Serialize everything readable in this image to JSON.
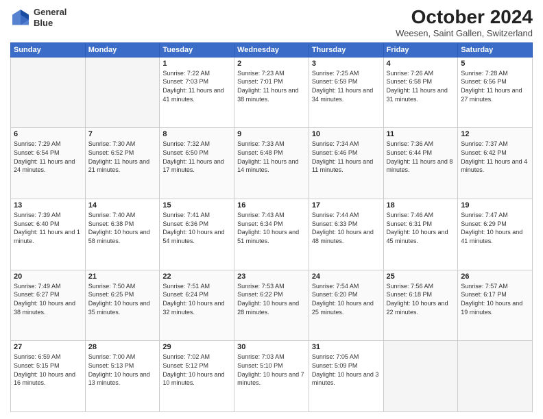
{
  "header": {
    "logo_line1": "General",
    "logo_line2": "Blue",
    "month": "October 2024",
    "location": "Weesen, Saint Gallen, Switzerland"
  },
  "weekdays": [
    "Sunday",
    "Monday",
    "Tuesday",
    "Wednesday",
    "Thursday",
    "Friday",
    "Saturday"
  ],
  "weeks": [
    [
      {
        "day": "",
        "empty": true
      },
      {
        "day": "",
        "empty": true
      },
      {
        "day": "1",
        "rise": "7:22 AM",
        "set": "7:03 PM",
        "daylight": "11 hours and 41 minutes."
      },
      {
        "day": "2",
        "rise": "7:23 AM",
        "set": "7:01 PM",
        "daylight": "11 hours and 38 minutes."
      },
      {
        "day": "3",
        "rise": "7:25 AM",
        "set": "6:59 PM",
        "daylight": "11 hours and 34 minutes."
      },
      {
        "day": "4",
        "rise": "7:26 AM",
        "set": "6:58 PM",
        "daylight": "11 hours and 31 minutes."
      },
      {
        "day": "5",
        "rise": "7:28 AM",
        "set": "6:56 PM",
        "daylight": "11 hours and 27 minutes."
      }
    ],
    [
      {
        "day": "6",
        "rise": "7:29 AM",
        "set": "6:54 PM",
        "daylight": "11 hours and 24 minutes."
      },
      {
        "day": "7",
        "rise": "7:30 AM",
        "set": "6:52 PM",
        "daylight": "11 hours and 21 minutes."
      },
      {
        "day": "8",
        "rise": "7:32 AM",
        "set": "6:50 PM",
        "daylight": "11 hours and 17 minutes."
      },
      {
        "day": "9",
        "rise": "7:33 AM",
        "set": "6:48 PM",
        "daylight": "11 hours and 14 minutes."
      },
      {
        "day": "10",
        "rise": "7:34 AM",
        "set": "6:46 PM",
        "daylight": "11 hours and 11 minutes."
      },
      {
        "day": "11",
        "rise": "7:36 AM",
        "set": "6:44 PM",
        "daylight": "11 hours and 8 minutes."
      },
      {
        "day": "12",
        "rise": "7:37 AM",
        "set": "6:42 PM",
        "daylight": "11 hours and 4 minutes."
      }
    ],
    [
      {
        "day": "13",
        "rise": "7:39 AM",
        "set": "6:40 PM",
        "daylight": "11 hours and 1 minute."
      },
      {
        "day": "14",
        "rise": "7:40 AM",
        "set": "6:38 PM",
        "daylight": "10 hours and 58 minutes."
      },
      {
        "day": "15",
        "rise": "7:41 AM",
        "set": "6:36 PM",
        "daylight": "10 hours and 54 minutes."
      },
      {
        "day": "16",
        "rise": "7:43 AM",
        "set": "6:34 PM",
        "daylight": "10 hours and 51 minutes."
      },
      {
        "day": "17",
        "rise": "7:44 AM",
        "set": "6:33 PM",
        "daylight": "10 hours and 48 minutes."
      },
      {
        "day": "18",
        "rise": "7:46 AM",
        "set": "6:31 PM",
        "daylight": "10 hours and 45 minutes."
      },
      {
        "day": "19",
        "rise": "7:47 AM",
        "set": "6:29 PM",
        "daylight": "10 hours and 41 minutes."
      }
    ],
    [
      {
        "day": "20",
        "rise": "7:49 AM",
        "set": "6:27 PM",
        "daylight": "10 hours and 38 minutes."
      },
      {
        "day": "21",
        "rise": "7:50 AM",
        "set": "6:25 PM",
        "daylight": "10 hours and 35 minutes."
      },
      {
        "day": "22",
        "rise": "7:51 AM",
        "set": "6:24 PM",
        "daylight": "10 hours and 32 minutes."
      },
      {
        "day": "23",
        "rise": "7:53 AM",
        "set": "6:22 PM",
        "daylight": "10 hours and 28 minutes."
      },
      {
        "day": "24",
        "rise": "7:54 AM",
        "set": "6:20 PM",
        "daylight": "10 hours and 25 minutes."
      },
      {
        "day": "25",
        "rise": "7:56 AM",
        "set": "6:18 PM",
        "daylight": "10 hours and 22 minutes."
      },
      {
        "day": "26",
        "rise": "7:57 AM",
        "set": "6:17 PM",
        "daylight": "10 hours and 19 minutes."
      }
    ],
    [
      {
        "day": "27",
        "rise": "6:59 AM",
        "set": "5:15 PM",
        "daylight": "10 hours and 16 minutes."
      },
      {
        "day": "28",
        "rise": "7:00 AM",
        "set": "5:13 PM",
        "daylight": "10 hours and 13 minutes."
      },
      {
        "day": "29",
        "rise": "7:02 AM",
        "set": "5:12 PM",
        "daylight": "10 hours and 10 minutes."
      },
      {
        "day": "30",
        "rise": "7:03 AM",
        "set": "5:10 PM",
        "daylight": "10 hours and 7 minutes."
      },
      {
        "day": "31",
        "rise": "7:05 AM",
        "set": "5:09 PM",
        "daylight": "10 hours and 3 minutes."
      },
      {
        "day": "",
        "empty": true
      },
      {
        "day": "",
        "empty": true
      }
    ]
  ]
}
